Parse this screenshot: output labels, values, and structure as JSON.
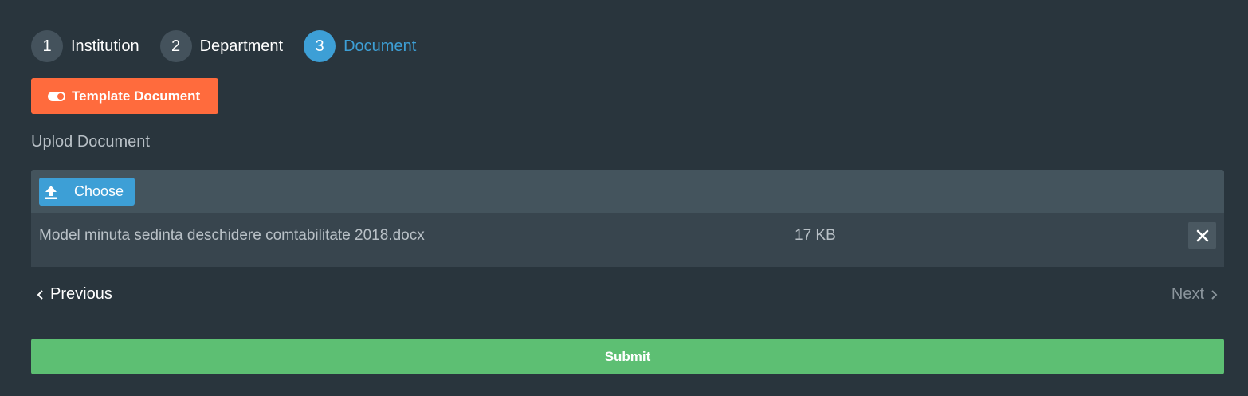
{
  "steps": [
    {
      "number": "1",
      "label": "Institution"
    },
    {
      "number": "2",
      "label": "Department"
    },
    {
      "number": "3",
      "label": "Document"
    }
  ],
  "template_button": {
    "label": "Template Document",
    "icon": "toggle-icon"
  },
  "upload": {
    "label": "Uplod Document",
    "choose_label": "Choose",
    "choose_icon": "upload-icon",
    "file": {
      "name": "Model minuta sedinta deschidere comtabilitate 2018.docx",
      "size": "17 KB"
    },
    "remove_icon": "close-icon"
  },
  "nav": {
    "previous_label": "Previous",
    "next_label": "Next"
  },
  "submit_label": "Submit",
  "colors": {
    "background": "#29353d",
    "accent": "#3d9fd6",
    "template_button": "#ff6b3d",
    "submit_button": "#5dbf73"
  }
}
